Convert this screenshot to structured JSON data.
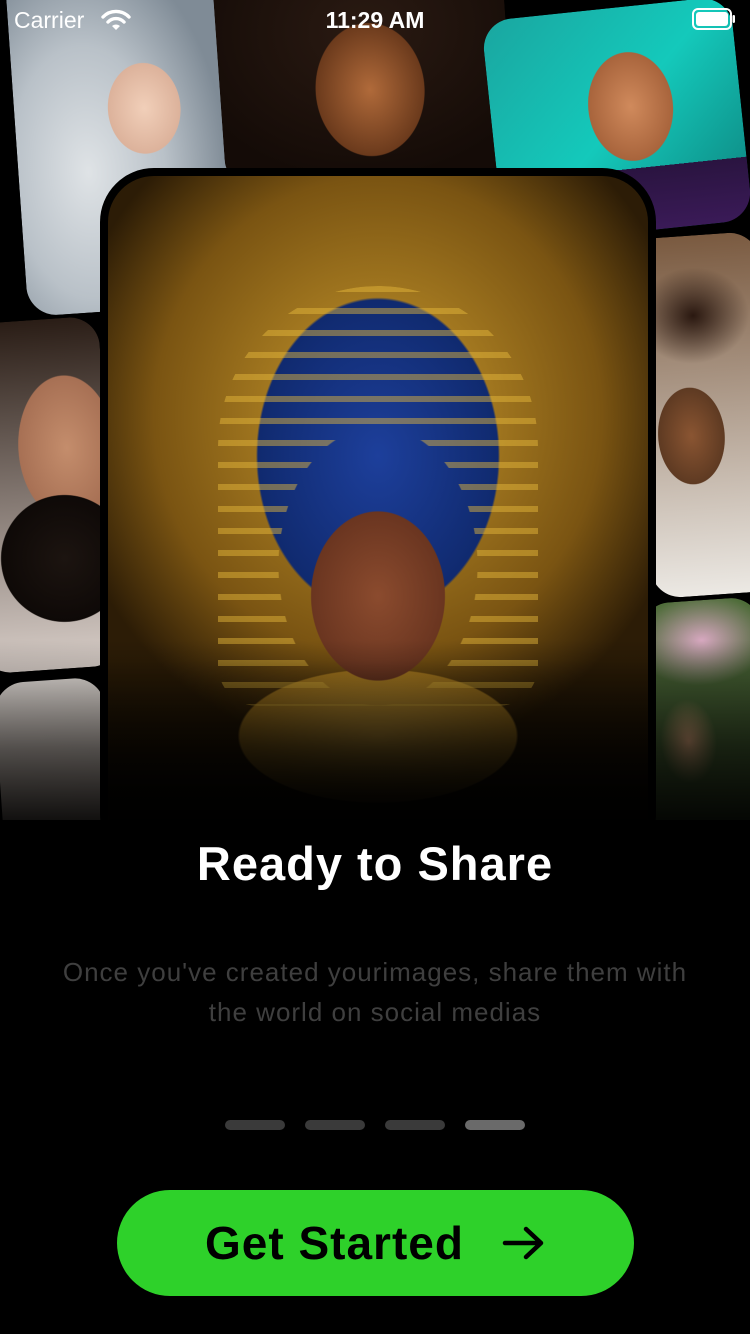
{
  "status_bar": {
    "carrier": "Carrier",
    "time": "11:29 AM",
    "wifi_icon": "wifi-icon",
    "battery_icon": "battery-icon"
  },
  "onboarding": {
    "title": "Ready to Share",
    "subtitle": "Once you've created yourimages, share them with the world on social medias",
    "page_count": 4,
    "active_page": 4,
    "cta_label": "Get Started",
    "cta_icon": "arrow-right-icon"
  },
  "colors": {
    "background": "#000000",
    "accent": "#2ED12A",
    "pager_inactive": "#3A3A3A",
    "pager_active": "#6A6A6A",
    "subtitle": "#3F3F3F"
  }
}
